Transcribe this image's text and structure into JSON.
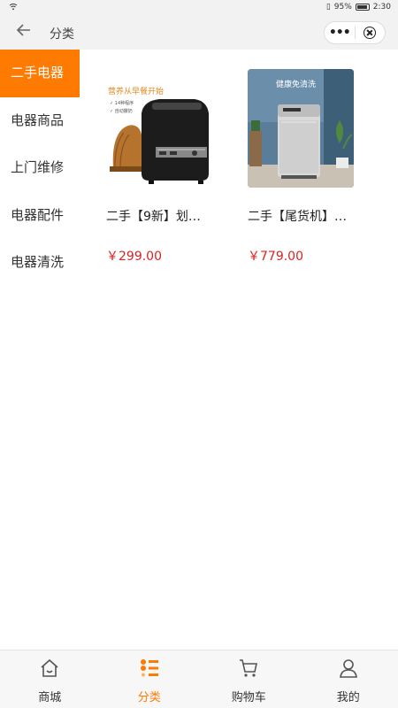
{
  "status_bar": {
    "battery": "95%",
    "time": "2:30"
  },
  "nav": {
    "title": "分类"
  },
  "sidebar": {
    "items": [
      {
        "label": "二手电器",
        "active": true
      },
      {
        "label": "电器商品",
        "active": false
      },
      {
        "label": "上门维修",
        "active": false
      },
      {
        "label": "电器配件",
        "active": false
      },
      {
        "label": "电器清洗",
        "active": false
      }
    ]
  },
  "products": [
    {
      "name": "二手【9新】划…",
      "price": "￥299.00",
      "image_caption": "营养从早餐开始",
      "image_lines": [
        "✓ 14种程序",
        "✓ 自动撒奶"
      ]
    },
    {
      "name": "二手【尾货机】…",
      "price": "￥779.00",
      "image_caption": "健康免清洗"
    }
  ],
  "tabbar": {
    "items": [
      {
        "label": "商城",
        "icon": "home-icon",
        "active": false
      },
      {
        "label": "分类",
        "icon": "category-icon",
        "active": true
      },
      {
        "label": "购物车",
        "icon": "cart-icon",
        "active": false
      },
      {
        "label": "我的",
        "icon": "user-icon",
        "active": false
      }
    ]
  },
  "colors": {
    "accent": "#ff7a00",
    "price": "#dd2222"
  }
}
